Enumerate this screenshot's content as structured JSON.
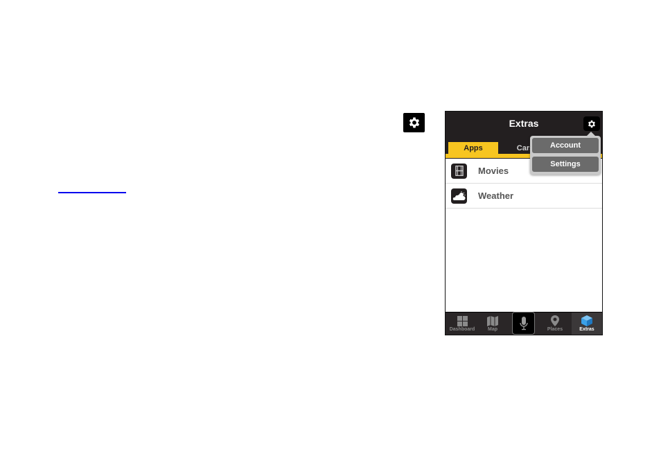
{
  "document": {
    "gear_icon": "gear-icon",
    "link_text": ""
  },
  "phone": {
    "navbar": {
      "title": "Extras",
      "settings_icon": "gear-icon"
    },
    "tabs": [
      {
        "label": "Apps",
        "active": true
      },
      {
        "label": "Cars",
        "active": false
      }
    ],
    "menu": {
      "items": [
        {
          "label": "Account"
        },
        {
          "label": "Settings"
        }
      ]
    },
    "list": [
      {
        "label": "Movies",
        "icon": "film-icon"
      },
      {
        "label": "Weather",
        "icon": "weather-cloud-sun-icon"
      }
    ],
    "tabbar": [
      {
        "label": "Dashboard",
        "icon": "grid-icon",
        "active": false
      },
      {
        "label": "Map",
        "icon": "map-icon",
        "active": false
      },
      {
        "label": "",
        "icon": "microphone-icon",
        "active": false
      },
      {
        "label": "Places",
        "icon": "location-pin-icon",
        "active": false
      },
      {
        "label": "Extras",
        "icon": "cube-icon",
        "active": true
      }
    ]
  },
  "colors": {
    "accent": "#f7c520",
    "bar_bg": "#231f20",
    "extras_icon": "#3aa0e8",
    "link": "#0000ee"
  }
}
